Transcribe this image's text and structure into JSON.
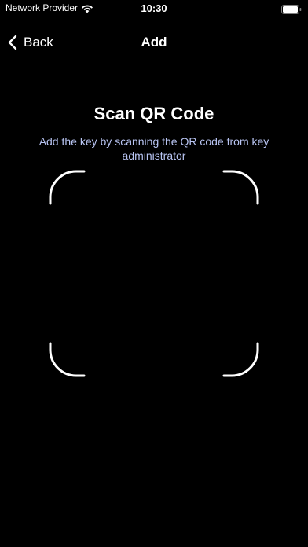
{
  "status_bar": {
    "carrier": "Network Provider",
    "time": "10:30"
  },
  "nav": {
    "back_label": "Back",
    "title": "Add"
  },
  "scanner": {
    "title": "Scan QR Code",
    "subtitle": "Add the key by scanning the QR code from key administrator",
    "frame_color": "#ffffff"
  },
  "colors": {
    "background": "#000000",
    "text_primary": "#ffffff",
    "subtitle": "#b8c4f2"
  },
  "icons": {
    "wifi": "wifi-icon",
    "battery": "battery-icon",
    "back": "chevron-left-icon"
  }
}
